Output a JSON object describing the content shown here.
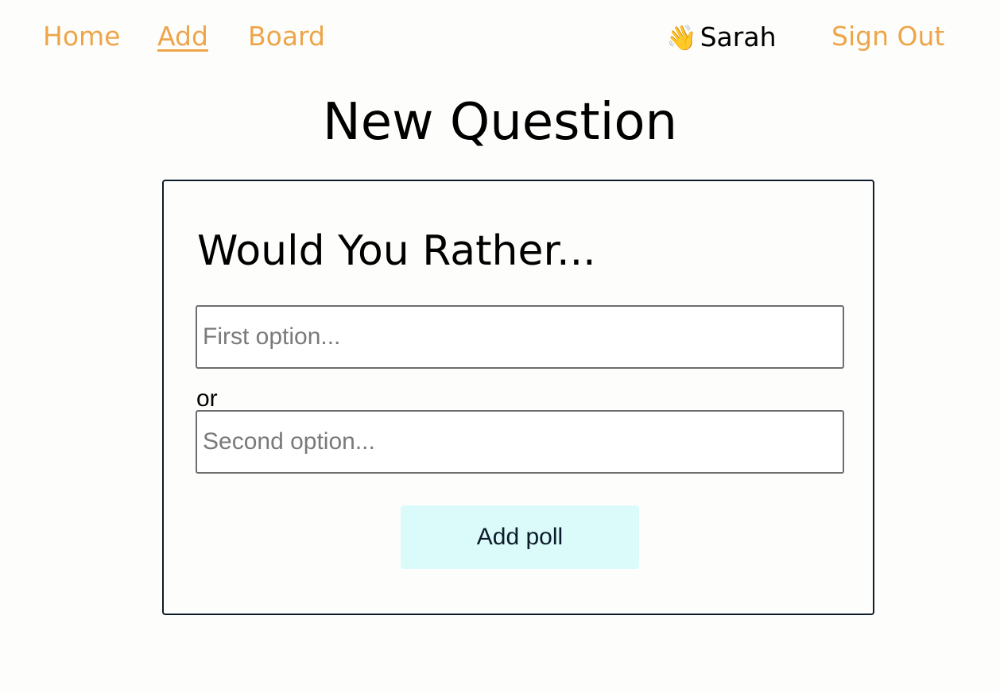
{
  "nav": {
    "home_label": "Home",
    "add_label": "Add",
    "board_label": "Board",
    "wave_glyph": "👋",
    "user_name": "Sarah",
    "signout_label": "Sign Out",
    "active_item": "Add",
    "link_color": "#eea54a"
  },
  "page": {
    "title": "New Question"
  },
  "form": {
    "heading": "Would You Rather...",
    "option_one": {
      "placeholder": "First option...",
      "value": ""
    },
    "separator": "or",
    "option_two": {
      "placeholder": "Second option...",
      "value": ""
    },
    "submit_label": "Add poll",
    "submit_color": "#dafbfa",
    "card_border_color": "#0d1b2a"
  }
}
